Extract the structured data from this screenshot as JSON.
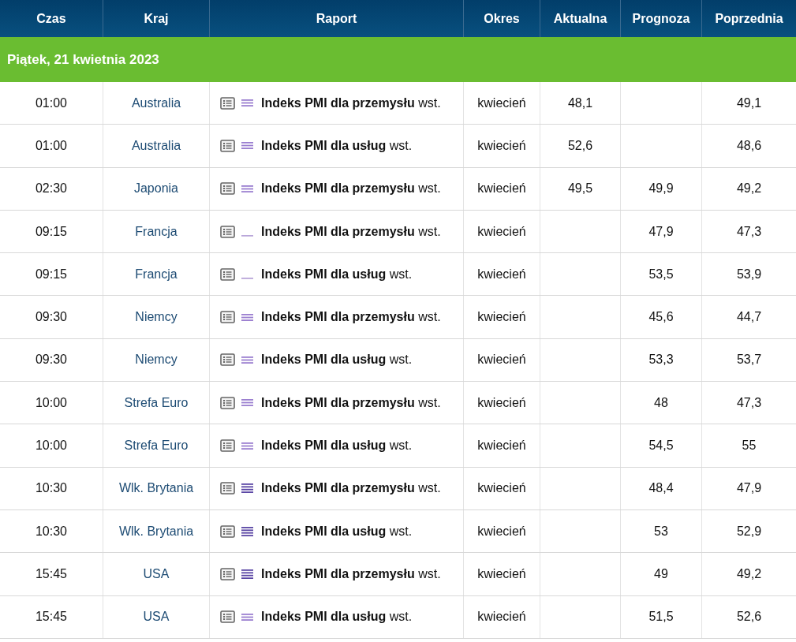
{
  "table": {
    "columns": [
      "Czas",
      "Kraj",
      "Raport",
      "Okres",
      "Aktualna",
      "Prognoza",
      "Poprzednia"
    ],
    "group": "Piątek, 21 kwietnia 2023",
    "rows": [
      {
        "time": "01:00",
        "country": "Australia",
        "kind": "medium",
        "report": "**Indeks PMI dla przemysłu** wst.",
        "period": "kwiecień",
        "actual": "48,1",
        "forecast": "",
        "previous": "49,1"
      },
      {
        "time": "01:00",
        "country": "Australia",
        "kind": "medium",
        "report": "**Indeks PMI dla usług** wst.",
        "period": "kwiecień",
        "actual": "52,6",
        "forecast": "",
        "previous": "48,6"
      },
      {
        "time": "02:30",
        "country": "Japonia",
        "kind": "medium",
        "report": "**Indeks PMI dla przemysłu** wst.",
        "period": "kwiecień",
        "actual": "49,5",
        "forecast": "49,9",
        "previous": "49,2"
      },
      {
        "time": "09:15",
        "country": "Francja",
        "kind": "low",
        "report": "**Indeks PMI dla przemysłu** wst.",
        "period": "kwiecień",
        "actual": "",
        "forecast": "47,9",
        "previous": "47,3"
      },
      {
        "time": "09:15",
        "country": "Francja",
        "kind": "low",
        "report": "**Indeks PMI dla usług** wst.",
        "period": "kwiecień",
        "actual": "",
        "forecast": "53,5",
        "previous": "53,9"
      },
      {
        "time": "09:30",
        "country": "Niemcy",
        "kind": "medium",
        "report": "**Indeks PMI dla przemysłu** wst.",
        "period": "kwiecień",
        "actual": "",
        "forecast": "45,6",
        "previous": "44,7"
      },
      {
        "time": "09:30",
        "country": "Niemcy",
        "kind": "medium",
        "report": "**Indeks PMI dla usług** wst.",
        "period": "kwiecień",
        "actual": "",
        "forecast": "53,3",
        "previous": "53,7"
      },
      {
        "time": "10:00",
        "country": "Strefa Euro",
        "kind": "medium",
        "report": "**Indeks PMI dla przemysłu** wst.",
        "period": "kwiecień",
        "actual": "",
        "forecast": "48",
        "previous": "47,3"
      },
      {
        "time": "10:00",
        "country": "Strefa Euro",
        "kind": "medium",
        "report": "**Indeks PMI dla usług** wst.",
        "period": "kwiecień",
        "actual": "",
        "forecast": "54,5",
        "previous": "55"
      },
      {
        "time": "10:30",
        "country": "Wlk. Brytania",
        "kind": "high",
        "report": "**Indeks PMI dla przemysłu** wst.",
        "period": "kwiecień",
        "actual": "",
        "forecast": "48,4",
        "previous": "47,9"
      },
      {
        "time": "10:30",
        "country": "Wlk. Brytania",
        "kind": "high",
        "report": "**Indeks PMI dla usług** wst.",
        "period": "kwiecień",
        "actual": "",
        "forecast": "53",
        "previous": "52,9"
      },
      {
        "time": "15:45",
        "country": "USA",
        "kind": "high",
        "report": "**Indeks PMI dla przemysłu** wst.",
        "period": "kwiecień",
        "actual": "",
        "forecast": "49",
        "previous": "49,2"
      },
      {
        "time": "15:45",
        "country": "USA",
        "kind": "medium",
        "report": "**Indeks PMI dla usług** wst.",
        "period": "kwiecień",
        "actual": "",
        "forecast": "51,5",
        "previous": "52,6"
      }
    ]
  }
}
